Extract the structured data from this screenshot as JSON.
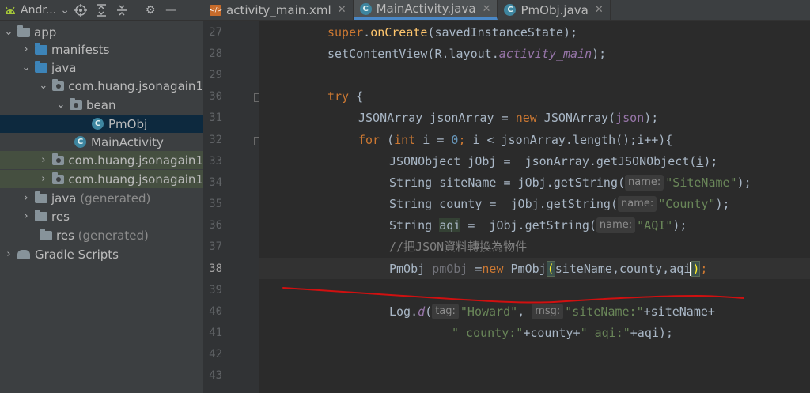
{
  "project_panel": {
    "title": "Andr..."
  },
  "tree": [
    {
      "label": "app"
    },
    {
      "label": "manifests"
    },
    {
      "label": "java"
    },
    {
      "label": "com.huang.jsonagain1"
    },
    {
      "label": "bean"
    },
    {
      "label": "PmObj"
    },
    {
      "label": "MainActivity"
    },
    {
      "label": "com.huang.jsonagain1"
    },
    {
      "label": "com.huang.jsonagain1"
    },
    {
      "label": "java",
      "suffix": "(generated)"
    },
    {
      "label": "res"
    },
    {
      "label": "res",
      "suffix": "(generated)"
    },
    {
      "label": "Gradle Scripts"
    }
  ],
  "tabs": [
    {
      "label": "activity_main.xml"
    },
    {
      "label": "MainActivity.java"
    },
    {
      "label": "PmObj.java"
    }
  ],
  "line_numbers": [
    "27",
    "28",
    "29",
    "30",
    "31",
    "32",
    "33",
    "34",
    "35",
    "36",
    "37",
    "38",
    "39",
    "40",
    "41",
    "42",
    "43"
  ],
  "code": {
    "l27": {
      "a": "super",
      "b": ".",
      "c": "onCreate",
      "d": "(savedInstanceState);"
    },
    "l28": {
      "a": "setContentView(R.layout.",
      "b": "activity_main",
      "c": ");"
    },
    "l30": {
      "a": "try",
      "b": " {"
    },
    "l31": {
      "a": "JSONArray jsonArray = ",
      "b": "new",
      "c": " JSONArray(",
      "d": "json",
      "e": ");"
    },
    "l32": {
      "a": "for",
      "b": " (",
      "c": "int",
      "d": " ",
      "e": "i",
      "f": " = ",
      "g": "0",
      "h": "; ",
      "i": "i",
      "j": " < jsonArray.length();",
      "k": "i",
      "l": "++){"
    },
    "l33": {
      "a": "JSONObject jObj =  jsonArray.getJSONObject(",
      "b": "i",
      "c": ");"
    },
    "l34": {
      "a": "String siteName = jObj.getString(",
      "hint": "name:",
      "s": "\"SiteName\"",
      "z": ");"
    },
    "l35": {
      "a": "String county =  jObj.getString(",
      "hint": "name:",
      "s": "\"County\"",
      "z": ");"
    },
    "l36": {
      "a": "String ",
      "b": "aqi",
      "c": " =  jObj.getString(",
      "hint": "name:",
      "s": "\"AQI\"",
      "z": ");"
    },
    "l37": {
      "comment": "//把JSON資料轉換為物件"
    },
    "l38": {
      "a": "PmObj ",
      "b": "pmObj",
      "c": " =",
      "d": "new",
      "e": " PmObj",
      "f": "(",
      "g": "siteName,county,aqi",
      "h": ")",
      "i": ";"
    },
    "l40": {
      "a": "Log.",
      "b": "d",
      "c": "(",
      "hint1": "tag:",
      "s1": "\"Howard\"",
      "d": ", ",
      "hint2": "msg:",
      "s2": "\"siteName:\"",
      "e": "+siteName+"
    },
    "l41": {
      "s1": "\" county:\"",
      "a": "+county+",
      "s2": "\" aqi:\"",
      "b": "+aqi);"
    }
  },
  "colors": {
    "accent": "#4a88c7",
    "keyword": "#cc7832",
    "string": "#6a8759",
    "annotation_scribble": "#d01010"
  }
}
